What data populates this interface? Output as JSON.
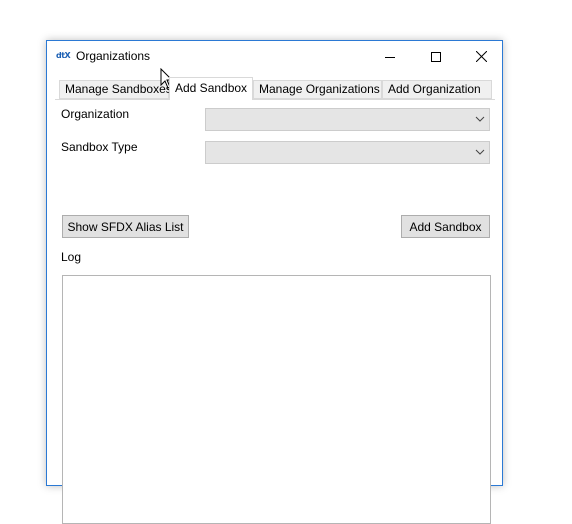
{
  "window": {
    "title": "Organizations",
    "icon_text": "dtX",
    "icon_name": "app-logo-icon",
    "controls": [
      "minimize-icon",
      "maximize-icon",
      "close-icon"
    ]
  },
  "tabs": [
    {
      "label": "Manage Sandboxes",
      "active": false
    },
    {
      "label": "Add Sandbox",
      "active": true
    },
    {
      "label": "Manage Organizations",
      "active": false
    },
    {
      "label": "Add Organization",
      "active": false
    }
  ],
  "form": {
    "organization_label": "Organization",
    "organization_value": "",
    "sandbox_type_label": "Sandbox Type",
    "sandbox_type_value": "",
    "show_alias_button": "Show SFDX Alias List",
    "add_sandbox_button": "Add Sandbox",
    "log_label": "Log",
    "log_value": ""
  },
  "colors": {
    "accent": "#2b79d4",
    "combo_bg": "#e5e5e5",
    "button_bg": "#e1e1e1"
  }
}
